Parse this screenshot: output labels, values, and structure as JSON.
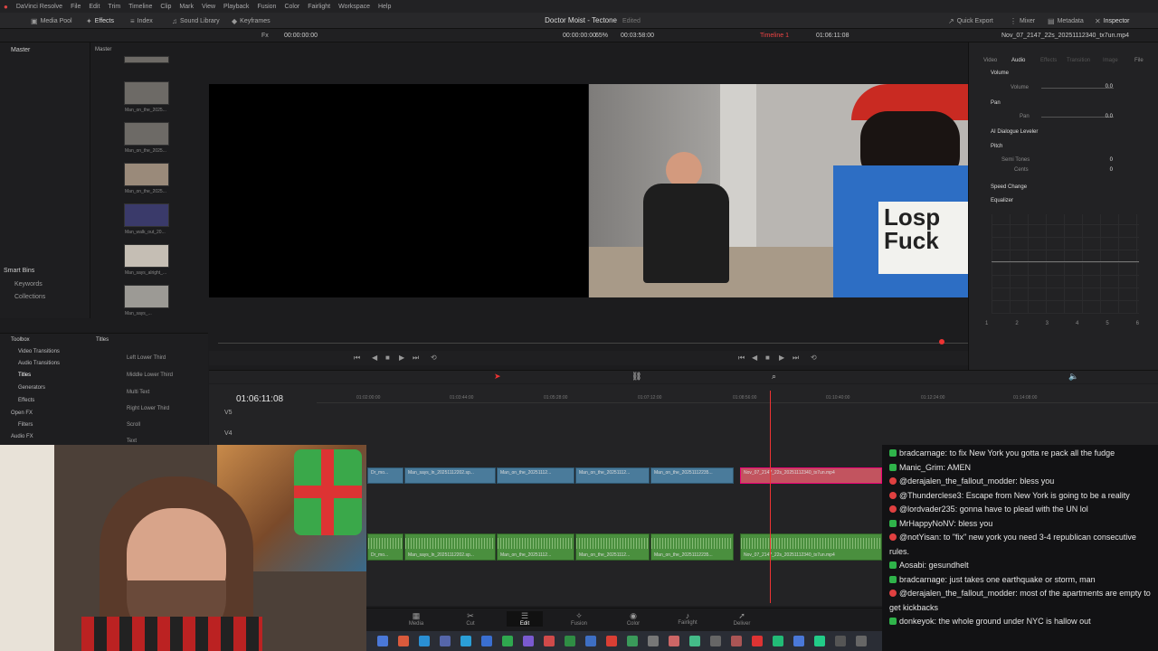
{
  "menubar": {
    "app": "DaVinci Resolve",
    "items": [
      "File",
      "Edit",
      "Trim",
      "Timeline",
      "Clip",
      "Mark",
      "View",
      "Playback",
      "Fusion",
      "Color",
      "Fairlight",
      "Workspace",
      "Help"
    ]
  },
  "toolbar": {
    "media_pool": "Media Pool",
    "effects": "Effects",
    "index": "Index",
    "sound_library": "Sound Library",
    "keyframes": "Keyframes",
    "quick_export": "Quick Export",
    "mixer": "Mixer",
    "metadata": "Metadata",
    "inspector": "Inspector"
  },
  "project": {
    "title": "Doctor Moist - Tectone",
    "status": "Edited"
  },
  "viewer": {
    "source_tc": "00:00:00:00",
    "tc_left": "00:00:00:00",
    "zoom": "65%",
    "duration": "00:03:58:00",
    "timeline_name": "Timeline 1",
    "timeline_tc": "01:06:11:08",
    "clip_name": "Nov_07_2147_22s_20251112340_tx7un.mp4",
    "fx": "Fx"
  },
  "bins": {
    "master": "Master",
    "header": "Master",
    "smart_bins": "Smart Bins",
    "keywords": "Keywords",
    "collections": "Collections"
  },
  "thumbs": [
    "Man_on_the_2025...",
    "Man_on_the_2025...",
    "Man_on_the_2025...",
    "Man_on_the_2025...",
    "Man_walk_out_20...",
    "Man_says_alright_...",
    "Man_says_..."
  ],
  "inspector": {
    "tabs": [
      "Video",
      "Audio",
      "Effects",
      "Transition",
      "Image",
      "File"
    ],
    "volume": "Volume",
    "volume_label": "Volume",
    "volume_val": "0.0",
    "pan": "Pan",
    "pan_label": "Pan",
    "pan_val": "0.0",
    "dialogue": "AI Dialogue Leveler",
    "pitch": "Pitch",
    "semitones": "Semi Tones",
    "semitones_val": "0",
    "cents": "Cents",
    "cents_val": "0",
    "speed": "Speed Change",
    "eq": "Equalizer",
    "bands": [
      "1",
      "2",
      "3",
      "4",
      "5",
      "6"
    ]
  },
  "toolbox": {
    "items": [
      "Toolbox",
      "Video Transitions",
      "Audio Transitions",
      "Titles",
      "Generators",
      "Effects",
      "Open FX",
      "Filters",
      "Audio FX"
    ],
    "titles_header": "Titles",
    "titles": [
      "Left Lower Third",
      "Middle Lower Third",
      "Multi Text",
      "Right Lower Third",
      "Scroll",
      "Text"
    ]
  },
  "timeline": {
    "timecode": "01:06:11:08",
    "tracks": [
      "V5",
      "V4"
    ],
    "ruler": [
      "01:02:00:00",
      "01:03:44:00",
      "01:05:28:00",
      "01:07:12:00",
      "01:08:56:00",
      "01:10:40:00",
      "01:12:24:00",
      "01:14:08:00"
    ],
    "video_clips": [
      "Dr_mo...",
      "Man_says_ln_20251112202.sp...",
      "Man_on_the_20251112...",
      "Man_on_the_20251112...",
      "Man_on_the_20251112235...",
      "Nov_07_2147_22s_20251112340_tx7un.mp4"
    ],
    "audio_clips": [
      "Dr_mo...",
      "Man_says_ln_20251112202.sp...",
      "Man_on_the_20251112...",
      "Man_on_the_20251112...",
      "Man_on_the_20251112235...",
      "Nov_07_2147_22s_20251112340_tx7un.mp4"
    ]
  },
  "pages": [
    "Media",
    "Cut",
    "Edit",
    "Fusion",
    "Color",
    "Fairlight",
    "Deliver"
  ],
  "chat": [
    {
      "user": "bradcarnage",
      "text": "to fix New York you gotta re pack all the fudge",
      "color": "#2fb34a"
    },
    {
      "user": "Manic_Grim",
      "text": "AMEN",
      "color": "#2fb34a"
    },
    {
      "user": "@derajalen_the_fallout_modder",
      "text": "bless you",
      "color": "#e04040"
    },
    {
      "user": "@Thunderclese3",
      "text": "Escape from New York is going to be a reality",
      "color": "#e04040"
    },
    {
      "user": "@lordvader235",
      "text": "gonna have to plead with the UN lol",
      "color": "#e04040"
    },
    {
      "user": "MrHappyNoNV",
      "text": "bless you",
      "color": "#2fb34a"
    },
    {
      "user": "@notYisan",
      "text": "to \"fix\" new york you need 3-4 republican consecutive rules.",
      "color": "#e04040"
    },
    {
      "user": "Aosabi",
      "text": "gesundhelt",
      "color": "#2fb34a"
    },
    {
      "user": "bradcarnage",
      "text": "just takes one earthquake or storm, man",
      "color": "#2fb34a"
    },
    {
      "user": "@derajalen_the_fallout_modder",
      "text": "most of the apartments are empty to get kickbacks",
      "color": "#e04040"
    },
    {
      "user": "donkeyok",
      "text": "the whole ground under NYC is hallow out",
      "color": "#2fb34a"
    }
  ],
  "colors": {
    "accent": "#e33",
    "video_clip": "#4a7b9b",
    "audio_clip": "#4a8f3e",
    "selected_clip": "#c2545f"
  }
}
